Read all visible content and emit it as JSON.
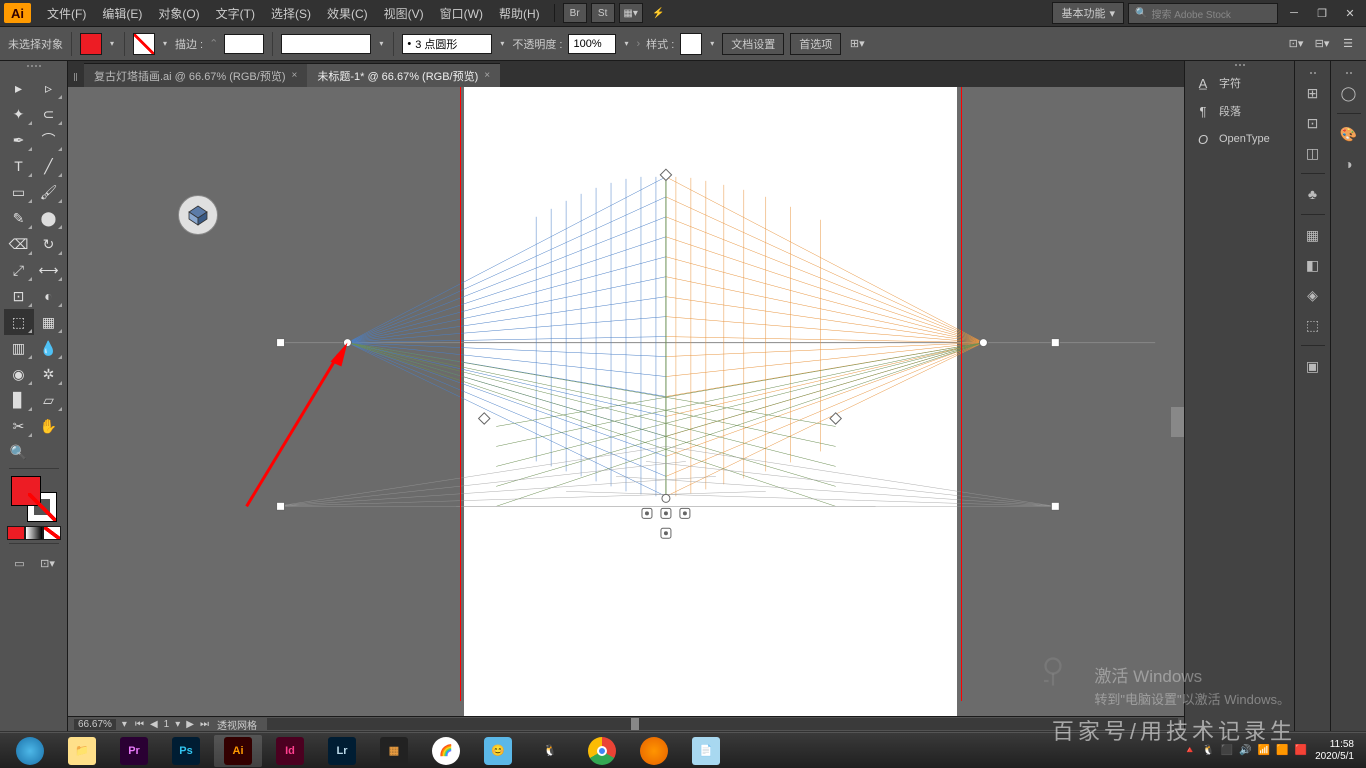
{
  "app": {
    "logo": "Ai"
  },
  "menu": {
    "file": "文件(F)",
    "edit": "编辑(E)",
    "object": "对象(O)",
    "type": "文字(T)",
    "select": "选择(S)",
    "effect": "效果(C)",
    "view": "视图(V)",
    "window": "窗口(W)",
    "help": "帮助(H)",
    "br": "Br",
    "st": "St"
  },
  "workspace": {
    "label": "基本功能"
  },
  "search": {
    "placeholder": "搜索 Adobe Stock"
  },
  "control": {
    "no_selection": "未选择对象",
    "stroke_label": "描边 :",
    "stroke_weight": "",
    "profile": "",
    "brush": "3 点圆形",
    "opacity_label": "不透明度 :",
    "opacity": "100%",
    "style_label": "样式 :",
    "doc_setup": "文档设置",
    "prefs": "首选项"
  },
  "tabs": {
    "t1": "复古灯塔插画.ai @ 66.67% (RGB/预览)",
    "t2": "未标题-1* @ 66.67% (RGB/预览)"
  },
  "status": {
    "zoom": "66.67%",
    "page": "1",
    "tool": "透视网格"
  },
  "panels": {
    "char": "字符",
    "para": "段落",
    "opentype": "OpenType"
  },
  "watermark": {
    "line1": "激活 Windows",
    "line2": "转到\"电脑设置\"以激活 Windows。",
    "bottom": "百家号/用技术记录生"
  },
  "taskbar": {
    "time": "11:58",
    "date": "2020/5/1"
  }
}
